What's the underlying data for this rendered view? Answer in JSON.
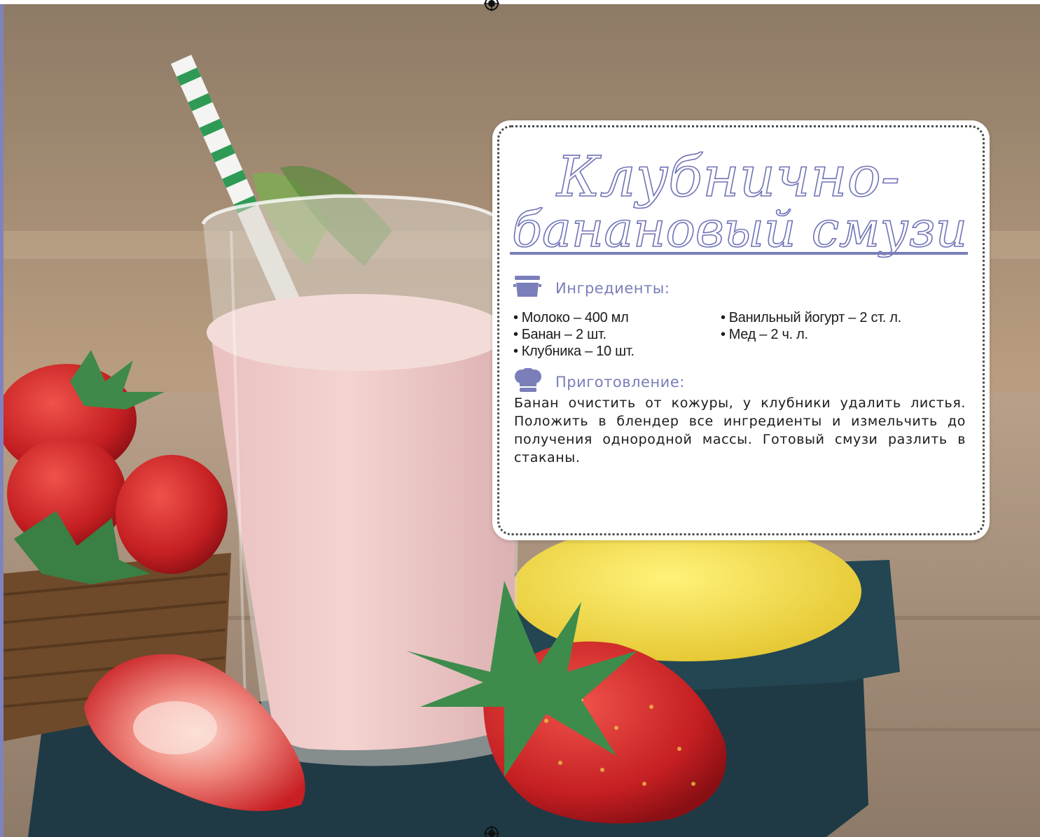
{
  "recipe": {
    "title_line1": "Клубнично-",
    "title_line2": "банановый смузи",
    "ingredients_heading": "Ингредиенты:",
    "ingredients_left": [
      "Молоко – 400 мл",
      "Банан – 2 шт.",
      "Клубника – 10 шт."
    ],
    "ingredients_right": [
      "Ванильный йогурт – 2 ст. л.",
      "Мед – 2 ч. л."
    ],
    "preparation_heading": "Приготовление:",
    "preparation_text": "Банан очистить от кожуры, у клубники удалить листья. Положить в блендер все ингредиенты и измельчить до получения однородной массы. Готовый смузи разлить в стаканы."
  },
  "icons": {
    "ingredients": "saucepan-icon",
    "preparation": "chef-hat-icon",
    "print_marks": "registration-mark-icon"
  },
  "colors": {
    "accent": "#7a7eb9",
    "title_outline": "#6f73b6",
    "text": "#1b1b1b",
    "card_background": "#ffffff",
    "side_strip": "#7f83bd"
  }
}
